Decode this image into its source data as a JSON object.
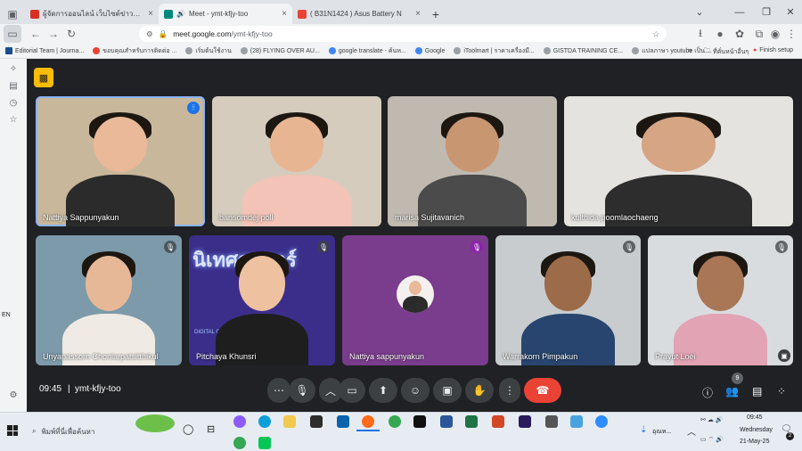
{
  "browser": {
    "tabs": [
      {
        "title": "ผู้จัดการออนไลน์ เว็บไซต์ข่าวชั้นนำของ",
        "favicon_color": "#d93025",
        "active": false
      },
      {
        "title": "Meet - ymt-kfjy-too",
        "favicon_color": "#00897b",
        "active": true
      },
      {
        "title": "( B31N1424 ) Asus Battery N",
        "favicon_color": "#ea4335",
        "active": false
      }
    ],
    "new_tab": "+",
    "url_host": "meet.google.com",
    "url_path": "/ymt-kfjy-too",
    "bookmarks": [
      "Editorial Team | Journa...",
      "ขอบคุณสำหรับการติดต่อ ...",
      "เริ่มต้นใช้งาน",
      "(28) FLYING OVER AU...",
      "google translate - ค้นห...",
      "Google",
      "iToolmart | ราคาเครื่องมื...",
      "GISTDA TRAINING CE...",
      "แปลภาษา youtube เป็น ..."
    ],
    "bookmarks_more": "»",
    "other_bookmarks": "ที่คั่นหน้าอื่นๆ",
    "finish_setup": "Finish setup"
  },
  "meet": {
    "time": "09:45",
    "meeting_code": "ymt-kfjy-too",
    "participant_count": "9",
    "participants": [
      {
        "name": "Nattiya Sappunyakun",
        "skin": "#e9b999",
        "shirt": "#2b2b2b",
        "bg": "#c9b79c",
        "speaking": true
      },
      {
        "name": "bansomdej poll",
        "skin": "#e8b593",
        "shirt": "#f2c3b6",
        "bg": "#d5ccbe"
      },
      {
        "name": "marisa Sujitavanich",
        "skin": "#c99672",
        "shirt": "#4b4b4b",
        "bg": "#bfb9b0"
      },
      {
        "name": "kulthida poomlaochaeng",
        "skin": "#d6a584",
        "shirt": "#2d2d2d",
        "bg": "#e5e3df"
      },
      {
        "name": "Unyapassorn Chonlarpatsitthikul",
        "skin": "#e7b898",
        "shirt": "#efeae3",
        "bg": "#7d9aaa"
      },
      {
        "name": "Pitchaya Khunsri",
        "skin": "#eec1a0",
        "shirt": "#1e1e1e",
        "bg": "#3b2d8a"
      },
      {
        "name": "Nattiya sappunyakun",
        "skin": "#e9b999",
        "shirt": "#2b2b2b",
        "bg": "#7a3c8c",
        "avatar": true
      },
      {
        "name": "Warrakorn Pimpakun",
        "skin": "#9c6b4a",
        "shirt": "#27456e",
        "bg": "#c8ccce"
      },
      {
        "name": "Prayut Loei",
        "skin": "#a97656",
        "shirt": "#e2a3b4",
        "bg": "#d9dcdf"
      }
    ],
    "video_sign": "นิเทศศาสตร์",
    "video_sign_sub": "DIGITAL COMMUNICATION ARTS",
    "input_lang": "EN"
  },
  "taskbar": {
    "search_placeholder": "พิมพ์ที่นี่เพื่อค้นหา",
    "weather": "อุณห...",
    "clock_time": "09:45",
    "clock_day": "Wednesday",
    "clock_date": "21-May-25",
    "notif_count": "2"
  },
  "colors": {
    "accent": "#1a73e8",
    "end_call": "#ea4335",
    "meet_bg": "#202124"
  }
}
